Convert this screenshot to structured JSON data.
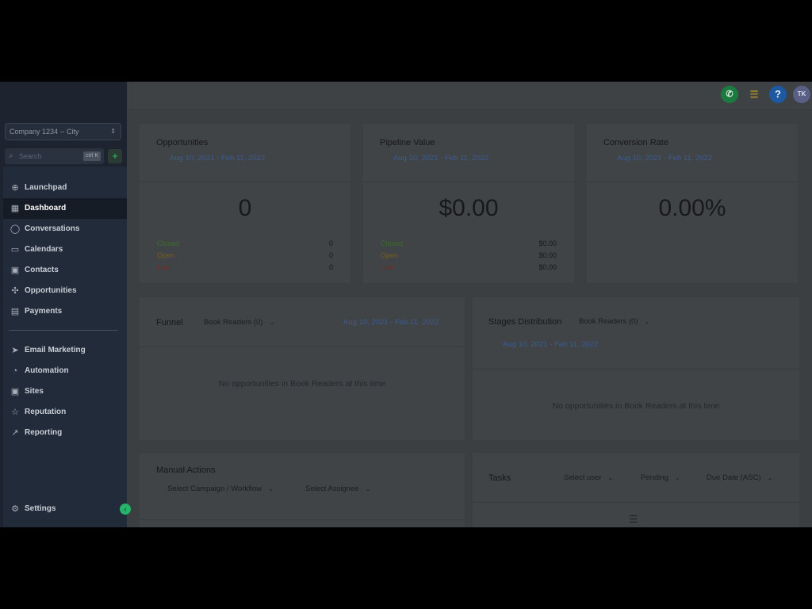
{
  "sidebar": {
    "company": "Company 1234 -- City",
    "search_placeholder": "Search",
    "search_shortcut": "ctrl K",
    "items": [
      {
        "label": "Launchpad",
        "icon": "launchpad-icon",
        "glyph": "⊕"
      },
      {
        "label": "Dashboard",
        "icon": "dashboard-icon",
        "glyph": "▦",
        "active": true
      },
      {
        "label": "Conversations",
        "icon": "chat-icon",
        "glyph": "◯"
      },
      {
        "label": "Calendars",
        "icon": "calendar-icon",
        "glyph": "▭"
      },
      {
        "label": "Contacts",
        "icon": "contacts-icon",
        "glyph": "▣"
      },
      {
        "label": "Opportunities",
        "icon": "opportunities-icon",
        "glyph": "✣"
      },
      {
        "label": "Payments",
        "icon": "payments-icon",
        "glyph": "▤"
      },
      {
        "label": "Email Marketing",
        "icon": "send-icon",
        "glyph": "➤"
      },
      {
        "label": "Automation",
        "icon": "automation-icon",
        "glyph": "◔"
      },
      {
        "label": "Sites",
        "icon": "sites-icon",
        "glyph": "▣"
      },
      {
        "label": "Reputation",
        "icon": "star-icon",
        "glyph": "☆"
      },
      {
        "label": "Reporting",
        "icon": "trend-icon",
        "glyph": "↗"
      },
      {
        "label": "Settings",
        "icon": "gear-icon",
        "glyph": "⚙"
      }
    ]
  },
  "topbar": {
    "avatar_initials": "TK"
  },
  "cards": {
    "opportunities": {
      "title": "Opportunities",
      "date_range": "Aug 10, 2021 - Feb 11, 2022",
      "value": "0",
      "rows": [
        {
          "label": "Closed",
          "value": "0"
        },
        {
          "label": "Open",
          "value": "0"
        },
        {
          "label": "Lost",
          "value": "0"
        }
      ]
    },
    "pipeline": {
      "title": "Pipeline Value",
      "date_range": "Aug 10, 2021 - Feb 11, 2022",
      "value": "$0.00",
      "rows": [
        {
          "label": "Closed",
          "value": "$0.00"
        },
        {
          "label": "Open",
          "value": "$0.00"
        },
        {
          "label": "Lost",
          "value": "$0.00"
        }
      ]
    },
    "conversion": {
      "title": "Conversion Rate",
      "date_range": "Aug 10, 2021 - Feb 11, 2022",
      "value": "0.00%"
    },
    "funnel": {
      "title": "Funnel",
      "pipeline_select": "Book Readers (0)",
      "date_range": "Aug 10, 2021 - Feb 11, 2022",
      "empty": "No opportunities in Book Readers at this time"
    },
    "stages": {
      "title": "Stages Distribution",
      "pipeline_select": "Book Readers (0)",
      "date_range": "Aug 10, 2021 - Feb 11, 2022",
      "empty": "No opportunities in Book Readers at this time"
    },
    "manual_actions": {
      "title": "Manual Actions",
      "campaign_select": "Select Campaign / Workflow",
      "assignee_select": "Select Assignee"
    },
    "tasks": {
      "title": "Tasks",
      "user_select": "Select user",
      "status_select": "Pending",
      "sort_select": "Due Date (ASC)"
    }
  },
  "colors": {
    "sidebar_bg": "#1d2430",
    "content_bg": "#3c3f42",
    "accent_green": "#27b36a",
    "help_blue": "#1d58a0"
  }
}
